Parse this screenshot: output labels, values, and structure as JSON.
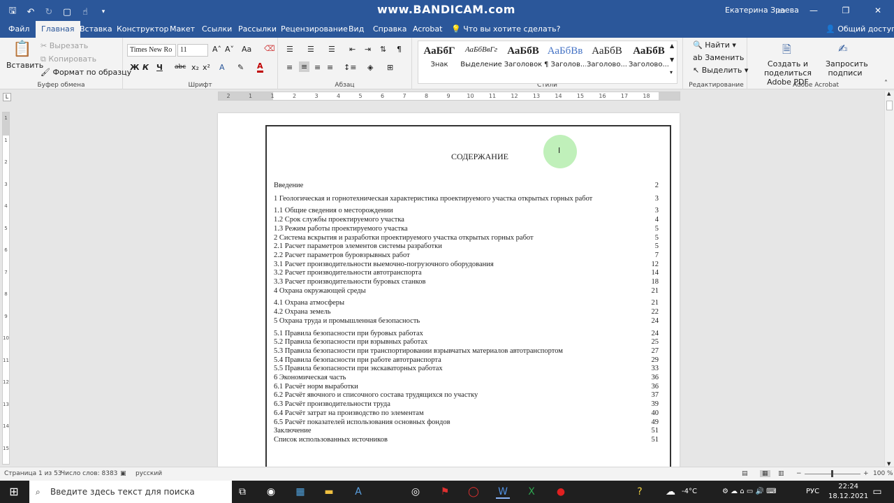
{
  "watermark": "www.BANDICAM.com",
  "user": "Екатерина Зраева",
  "tabs": [
    "Файл",
    "Главная",
    "Вставка",
    "Конструктор",
    "Макет",
    "Ссылки",
    "Рассылки",
    "Рецензирование",
    "Вид",
    "Справка",
    "Acrobat"
  ],
  "tell_me": "Что вы хотите сделать?",
  "share": "Общий доступ",
  "clipboard": {
    "paste": "Вставить",
    "cut": "Вырезать",
    "copy": "Копировать",
    "format_painter": "Формат по образцу",
    "label": "Буфер обмена"
  },
  "font": {
    "name": "Times New Ro",
    "size": "11",
    "label": "Шрифт",
    "bold": "Ж",
    "italic": "К",
    "underline": "Ч",
    "strike": "abc",
    "sub": "x₂",
    "sup": "x²",
    "aa": "Aa"
  },
  "paragraph": {
    "label": "Абзац"
  },
  "styles": {
    "label": "Стили",
    "items": [
      {
        "preview": "АаБбГ",
        "name": "Знак"
      },
      {
        "preview": "АаБбВвГг",
        "name": "Выделение"
      },
      {
        "preview": "АаБбВ",
        "name": "Заголовок"
      },
      {
        "preview": "АаБбВв",
        "name": "¶ Заголов..."
      },
      {
        "preview": "АаБбВ",
        "name": "Заголово..."
      },
      {
        "preview": "АаБбВ",
        "name": "Заголово..."
      }
    ]
  },
  "editing": {
    "find": "Найти",
    "replace": "Заменить",
    "select": "Выделить",
    "label": "Редактирование"
  },
  "acrobat": {
    "create": "Создать и поделиться Adobe PDF",
    "request": "Запросить подписи",
    "label": "Adobe Acrobat"
  },
  "ruler_h": [
    "2",
    "1",
    "1",
    "2",
    "3",
    "4",
    "5",
    "6",
    "7",
    "8",
    "9",
    "10",
    "11",
    "12",
    "13",
    "14",
    "15",
    "16",
    "17",
    "18"
  ],
  "ruler_v": [
    "1",
    "1",
    "2",
    "3",
    "4",
    "5",
    "6",
    "7",
    "8",
    "9",
    "10",
    "11",
    "12",
    "13",
    "14",
    "15"
  ],
  "document": {
    "title": "СОДЕРЖАНИЕ",
    "entries": [
      {
        "text": "Введение",
        "page": "2"
      },
      {
        "text": "1 Геологическая и горнотехническая характеристика проектируемого участка открытых горных работ",
        "page": "3"
      },
      {
        "text": "1.1 Общие сведения о месторождении",
        "page": "3"
      },
      {
        "text": "1.2 Срок службы проектируемого участка",
        "page": "4"
      },
      {
        "text": "1.3 Режим работы проектируемого участка",
        "page": "5"
      },
      {
        "text": "2 Система вскрытия и разработки проектируемого участка открытых горных работ",
        "page": "5"
      },
      {
        "text": "2.1 Расчет параметров элементов системы разработки",
        "page": "5"
      },
      {
        "text": "2.2 Расчет параметров буровзрывных работ",
        "page": "7"
      },
      {
        "text": "3.1 Расчет производительности выемочно-погрузочного оборудования",
        "page": "12"
      },
      {
        "text": "3.2 Расчет производительности автотранспорта",
        "page": "14"
      },
      {
        "text": "3.3 Расчет производительности буровых станков",
        "page": "18"
      },
      {
        "text": "4 Охрана окружающей среды",
        "page": "21"
      },
      {
        "text": "4.1 Охрана атмосферы",
        "page": "21"
      },
      {
        "text": "4.2 Охрана земель",
        "page": "22"
      },
      {
        "text": "5 Охрана труда и промышленная безопасность",
        "page": "24"
      },
      {
        "text": "5.1 Правила безопасности при буровых работах",
        "page": "24"
      },
      {
        "text": "5.2 Правила безопасности при взрывных работах",
        "page": "25"
      },
      {
        "text": "5.3 Правила безопасности при транспортировании взрывчатых материалов автотранспортом",
        "page": "27"
      },
      {
        "text": "5.4 Правила безопасности при работе автотранспорта",
        "page": "29"
      },
      {
        "text": "5.5 Правила безопасности при экскаваторных работах",
        "page": "33"
      },
      {
        "text": "6 Экономическая часть",
        "page": "36"
      },
      {
        "text": "6.1 Расчёт норм выработки",
        "page": "36"
      },
      {
        "text": "6.2 Расчёт явочного и списочного состава трудящихся по участку",
        "page": "37"
      },
      {
        "text": "6.3 Расчёт производительности труда",
        "page": "39"
      },
      {
        "text": "6.4 Расчёт затрат на производство по элементам",
        "page": "40"
      },
      {
        "text": "6.5 Расчёт показателей использования основных фондов",
        "page": "49"
      },
      {
        "text": "Заключение",
        "page": "51"
      },
      {
        "text": "Список использованных источников",
        "page": "51"
      }
    ]
  },
  "status": {
    "page": "Страница 1 из 53",
    "words": "Число слов: 8383",
    "lang": "русский",
    "zoom": "100 %"
  },
  "taskbar": {
    "search": "Введите здесь текст для поиска",
    "temp": "-4°C",
    "lang": "РУС",
    "time": "22:24",
    "date": "18.12.2021"
  }
}
